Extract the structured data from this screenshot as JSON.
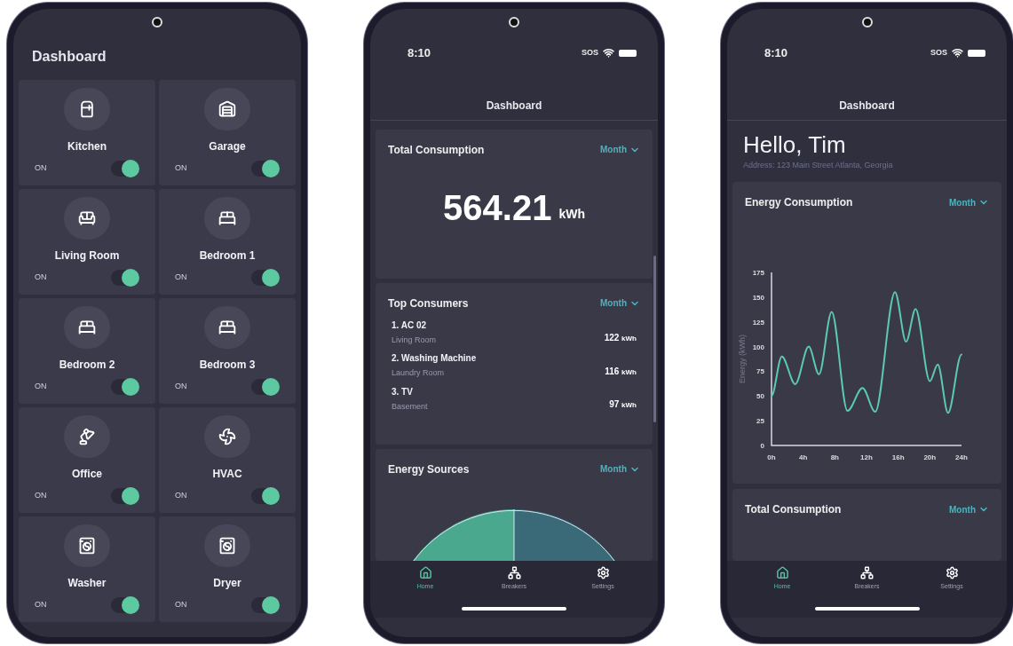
{
  "phones": [
    {
      "kind": "rooms",
      "title": "Dashboard",
      "rooms": [
        {
          "name": "Kitchen",
          "state_label": "ON",
          "on": true
        },
        {
          "name": "Garage",
          "state_label": "ON",
          "on": true
        },
        {
          "name": "Living Room",
          "state_label": "ON",
          "on": true
        },
        {
          "name": "Bedroom 1",
          "state_label": "ON",
          "on": true
        },
        {
          "name": "Bedroom 2",
          "state_label": "ON",
          "on": true
        },
        {
          "name": "Bedroom 3",
          "state_label": "ON",
          "on": true
        },
        {
          "name": "Office",
          "state_label": "ON",
          "on": true
        },
        {
          "name": "HVAC",
          "state_label": "ON",
          "on": true
        },
        {
          "name": "Washer",
          "state_label": "ON",
          "on": true
        },
        {
          "name": "Dryer",
          "state_label": "ON",
          "on": true
        }
      ]
    },
    {
      "kind": "summary",
      "status_bar": {
        "time": "8:10",
        "carrier": "SOS"
      },
      "header": "Dashboard",
      "cards": [
        {
          "kind": "total",
          "title": "Total Consumption",
          "period": "Month",
          "value": "564.21",
          "unit": "kWh"
        },
        {
          "kind": "consumers",
          "title": "Top Consumers",
          "period": "Month",
          "items": [
            {
              "name": "1. AC 02",
              "room": "Living Room",
              "value": "122",
              "unit": "kWh"
            },
            {
              "name": "2. Washing Machine",
              "room": "Laundry Room",
              "value": "116",
              "unit": "kWh"
            },
            {
              "name": "3. TV",
              "room": "Basement",
              "value": "97",
              "unit": "kWh"
            }
          ]
        },
        {
          "kind": "sources",
          "title": "Energy Sources",
          "period": "Month"
        }
      ],
      "nav": [
        {
          "label": "Home",
          "selected": true
        },
        {
          "label": "Breakers",
          "selected": false
        },
        {
          "label": "Settings",
          "selected": false
        }
      ]
    },
    {
      "kind": "home",
      "status_bar": {
        "time": "8:10",
        "carrier": "SOS"
      },
      "header": "Dashboard",
      "greeting": "Hello, Tim",
      "address": "Address: 123 Main Street Atlanta, Georgia",
      "cards": [
        {
          "kind": "chart",
          "title": "Energy Consumption",
          "period": "Month",
          "chart_data": {
            "type": "line",
            "ylabel": "Energy (kWh)",
            "x": [
              0,
              1.3,
              3,
              4.7,
              6,
              7.6,
              9.6,
              11.5,
              13.1,
              15.6,
              17,
              18.2,
              20,
              21,
              22.3,
              24
            ],
            "series": [
              {
                "color": "#5cc9b0",
                "values": [
                  50,
                  90,
                  62,
                  100,
                  72,
                  135,
                  35,
                  58,
                  34,
                  155,
                  105,
                  138,
                  65,
                  82,
                  33,
                  92
                ]
              }
            ],
            "xlim": [
              0,
              24
            ],
            "ylim": [
              0,
              175
            ],
            "xticks": [
              {
                "value": 0,
                "label": "0h"
              },
              {
                "value": 4,
                "label": "4h"
              },
              {
                "value": 8,
                "label": "8h"
              },
              {
                "value": 12,
                "label": "12h"
              },
              {
                "value": 16,
                "label": "16h"
              },
              {
                "value": 20,
                "label": "20h"
              },
              {
                "value": 24,
                "label": "24h"
              }
            ],
            "yticks": [
              0,
              25,
              50,
              75,
              100,
              125,
              150,
              175
            ]
          }
        },
        {
          "kind": "total",
          "title": "Total Consumption",
          "period": "Month"
        }
      ],
      "nav": [
        {
          "label": "Home",
          "selected": true
        },
        {
          "label": "Breakers",
          "selected": false
        },
        {
          "label": "Settings",
          "selected": false
        }
      ]
    }
  ]
}
